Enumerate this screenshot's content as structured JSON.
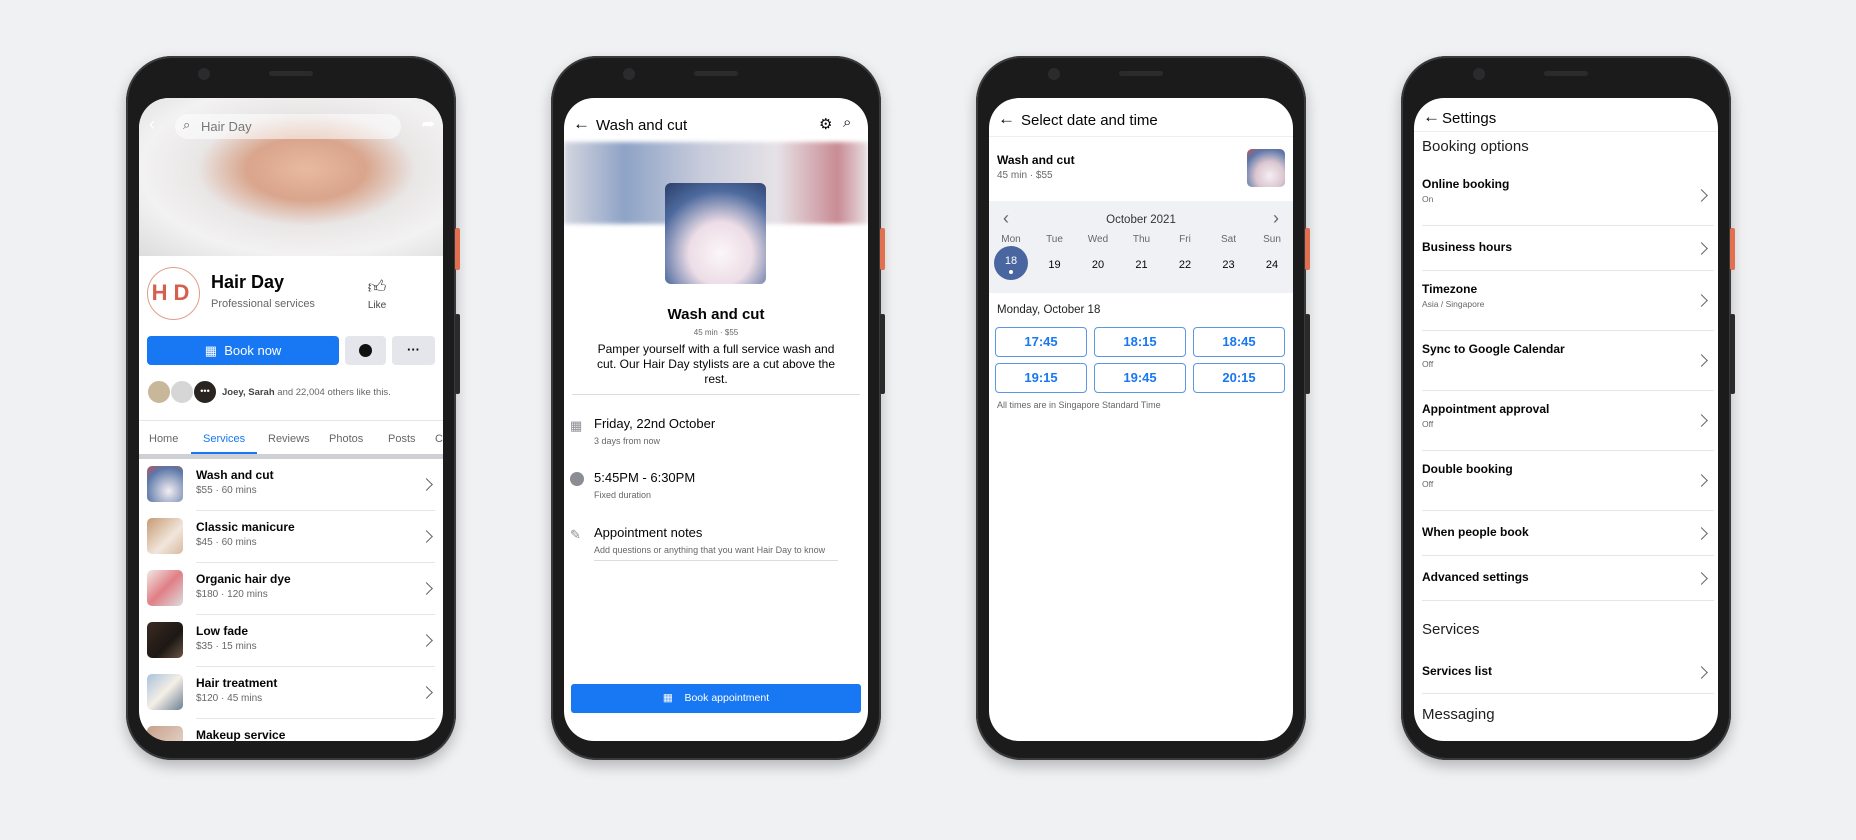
{
  "profile_screen": {
    "search_value": "Hair Day",
    "page_name": "Hair Day",
    "category": "Professional services",
    "logo_text": "HD",
    "like_label": "Like",
    "book_now_label": "Book now",
    "more_label": "···",
    "likers_names": "Joey, Sarah",
    "likers_rest": " and 22,004 others like this.",
    "tabs": [
      "Home",
      "Services",
      "Reviews",
      "Photos",
      "Posts",
      "C"
    ],
    "active_tab": "Services",
    "services": [
      {
        "name": "Wash and cut",
        "meta": "$55 · 60 mins"
      },
      {
        "name": "Classic manicure",
        "meta": "$45 · 60 mins"
      },
      {
        "name": "Organic hair dye",
        "meta": "$180 · 120 mins"
      },
      {
        "name": "Low fade",
        "meta": "$35 · 15 mins"
      },
      {
        "name": "Hair treatment",
        "meta": "$120 · 45 mins"
      },
      {
        "name": "Makeup service",
        "meta": ""
      }
    ]
  },
  "service_screen": {
    "title": "Wash and cut",
    "service_name": "Wash and cut",
    "meta": "45 min · $55",
    "description": "Pamper yourself with a full service wash and cut. Our Hair Day stylists are a cut above the rest.",
    "date": "Friday, 22nd October",
    "date_sub": "3 days from now",
    "time": "5:45PM - 6:30PM",
    "time_sub": "Fixed duration",
    "notes_label": "Appointment notes",
    "notes_placeholder": "Add questions or anything that you want Hair Day to know",
    "book_label": "Book appointment"
  },
  "datetime_screen": {
    "title": "Select date and time",
    "service_name": "Wash and cut",
    "service_meta": "45 min · $55",
    "month": "October 2021",
    "day_names": [
      "Mon",
      "Tue",
      "Wed",
      "Thu",
      "Fri",
      "Sat",
      "Sun"
    ],
    "dates": [
      "18",
      "19",
      "20",
      "21",
      "22",
      "23",
      "24"
    ],
    "selected_date": "18",
    "selected_label": "Monday, October 18",
    "slots": [
      "17:45",
      "18:15",
      "18:45",
      "19:15",
      "19:45",
      "20:15"
    ],
    "footnote": "All times are in Singapore Standard Time",
    "accent": "#4a66a0"
  },
  "settings_screen": {
    "title": "Settings",
    "section_booking": "Booking options",
    "rows": [
      {
        "label": "Online booking",
        "sub": "On"
      },
      {
        "label": "Business hours",
        "sub": ""
      },
      {
        "label": "Timezone",
        "sub": "Asia / Singapore"
      },
      {
        "label": "Sync to Google Calendar",
        "sub": "Off"
      },
      {
        "label": "Appointment approval",
        "sub": "Off"
      },
      {
        "label": "Double booking",
        "sub": "Off"
      },
      {
        "label": "When people book",
        "sub": ""
      },
      {
        "label": "Advanced settings",
        "sub": ""
      }
    ],
    "section_services": "Services",
    "services_list": "Services list",
    "section_messaging": "Messaging"
  },
  "colors": {
    "brand_blue": "#1877f2",
    "side_button": "#e0704f"
  }
}
